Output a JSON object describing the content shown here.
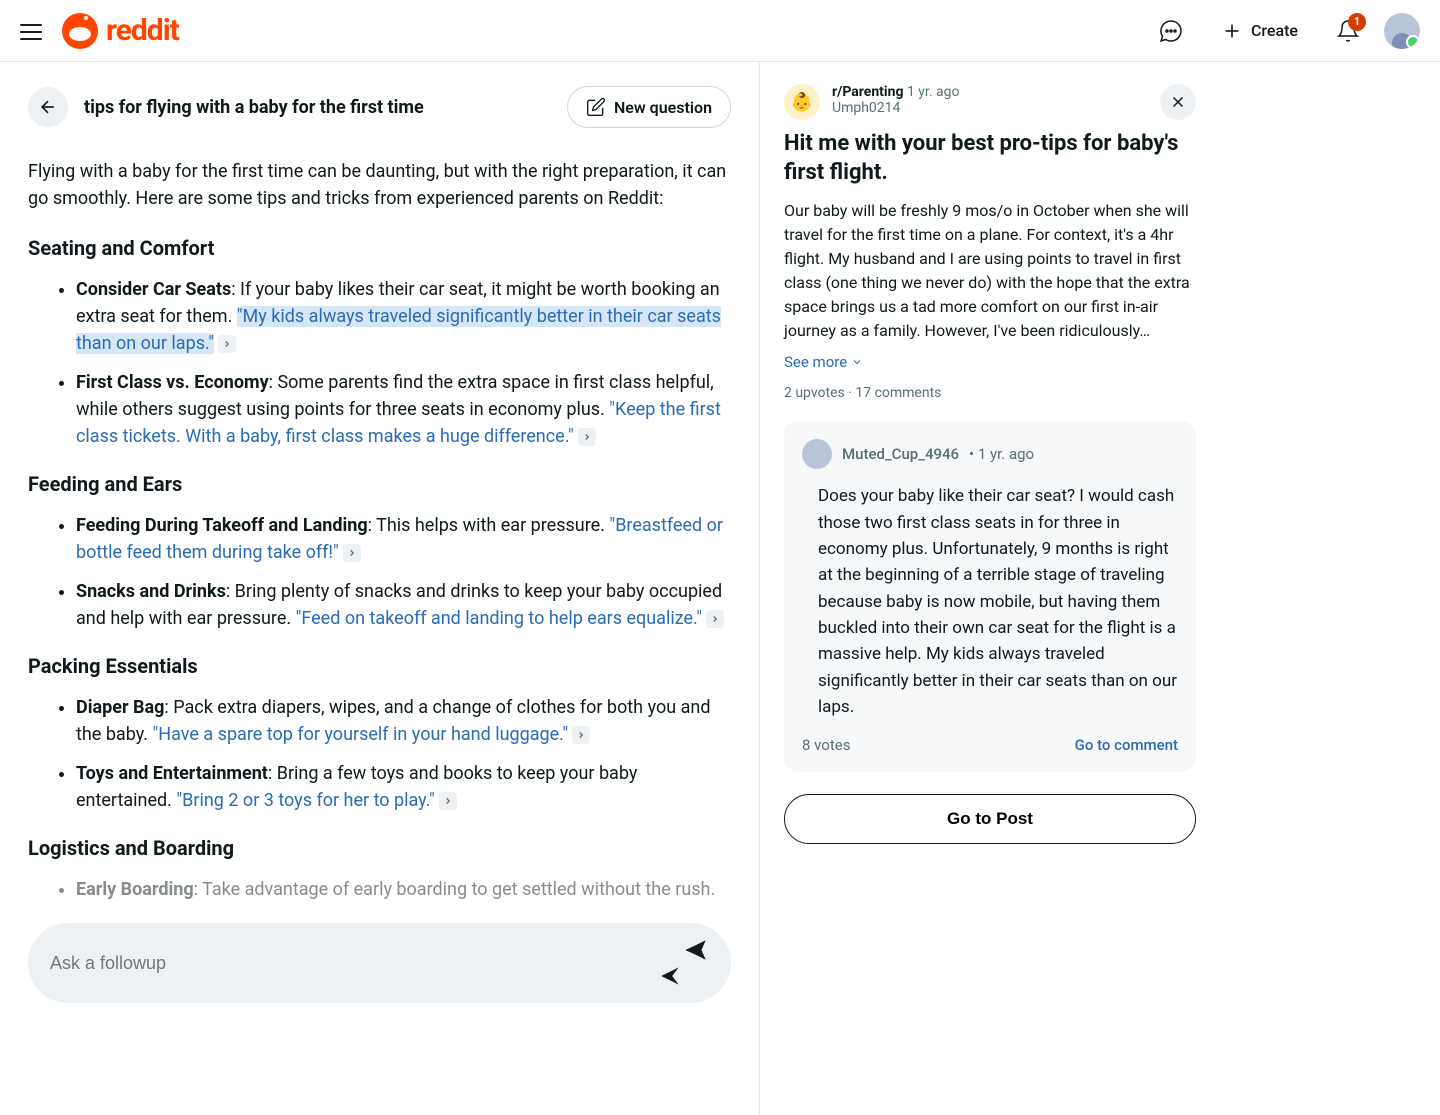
{
  "header": {
    "logo_text": "reddit",
    "create_label": "Create",
    "notification_count": "1"
  },
  "query": {
    "title": "tips for flying with a baby for the first time",
    "new_question_label": "New question",
    "intro": "Flying with a baby for the first time can be daunting, but with the right preparation, it can go smoothly. Here are some tips and tricks from experienced parents on Reddit:",
    "followup_placeholder": "Ask a followup"
  },
  "sections": [
    {
      "title": "Seating and Comfort",
      "items": [
        {
          "bold": "Consider Car Seats",
          "text": ": If your baby likes their car seat, it might be worth booking an extra seat for them. ",
          "quote": "\"My kids always traveled significantly better in their car seats than on our laps.\"",
          "selected": true
        },
        {
          "bold": "First Class vs. Economy",
          "text": ": Some parents find the extra space in first class helpful, while others suggest using points for three seats in economy plus. ",
          "quote": "\"Keep the first class tickets. With a baby, first class makes a huge difference.\"",
          "selected": false
        }
      ]
    },
    {
      "title": "Feeding and Ears",
      "items": [
        {
          "bold": "Feeding During Takeoff and Landing",
          "text": ": This helps with ear pressure. ",
          "quote": "\"Breastfeed or bottle feed them during take off!\"",
          "selected": false
        },
        {
          "bold": "Snacks and Drinks",
          "text": ": Bring plenty of snacks and drinks to keep your baby occupied and help with ear pressure. ",
          "quote": "\"Feed on takeoff and landing to help ears equalize.\"",
          "selected": false
        }
      ]
    },
    {
      "title": "Packing Essentials",
      "items": [
        {
          "bold": "Diaper Bag",
          "text": ": Pack extra diapers, wipes, and a change of clothes for both you and the baby. ",
          "quote": "\"Have a spare top for yourself in your hand luggage.\"",
          "selected": false
        },
        {
          "bold": "Toys and Entertainment",
          "text": ": Bring a few toys and books to keep your baby entertained. ",
          "quote": "\"Bring 2 or 3 toys for her to play.\"",
          "selected": false
        }
      ]
    },
    {
      "title": "Logistics and Boarding",
      "items": [
        {
          "bold": "Early Boarding",
          "text": ": Take advantage of early boarding to get settled without the rush.",
          "quote": "",
          "selected": false,
          "faded": true
        }
      ]
    }
  ],
  "post": {
    "subreddit": "r/Parenting",
    "age": "1 yr. ago",
    "author": "Umph0214",
    "title": "Hit me with your best pro-tips for baby's first flight.",
    "body": "Our baby will be freshly 9 mos/o in October when she will travel for the first time on a plane. For context, it's a 4hr flight. My husband and I are using points to travel in first class (one thing we never do) with the hope that the extra space brings us a tad more comfort on our first in-air journey as a family. However, I've been ridiculously…",
    "see_more": "See more",
    "upvotes": "2 upvotes",
    "comments": "17 comments",
    "go_to_post": "Go to Post"
  },
  "comment": {
    "user": "Muted_Cup_4946",
    "age": "1 yr. ago",
    "body": "Does your baby like their car seat? I would cash those two first class seats in for three in economy plus. Unfortunately, 9 months is right at the beginning of a terrible stage of traveling because baby is now mobile, but having them buckled into their own car seat for the flight is a massive help. My kids always traveled significantly better in their car seats than on our laps.",
    "votes": "8 votes",
    "go_to_comment": "Go to comment"
  }
}
